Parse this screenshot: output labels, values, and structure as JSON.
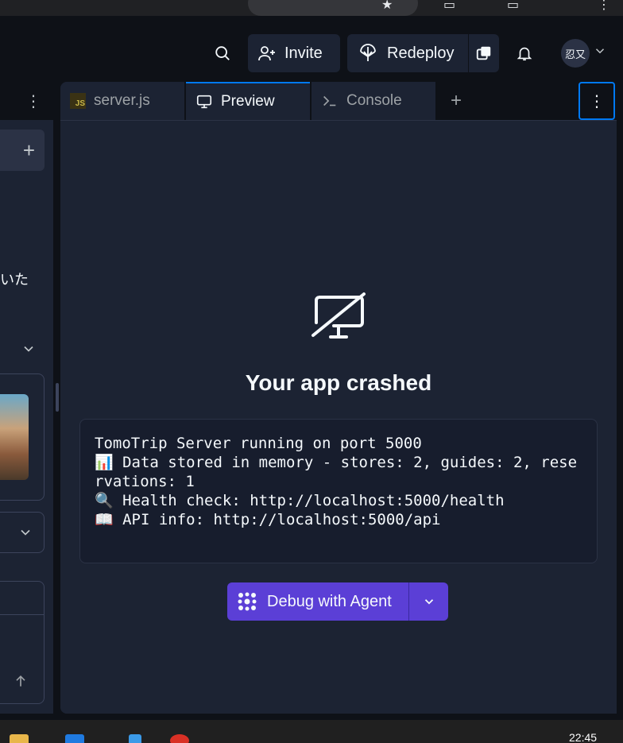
{
  "header": {
    "invite_label": "Invite",
    "redeploy_label": "Redeploy",
    "avatar_text": "忍又"
  },
  "tabs": [
    {
      "label": "server.js",
      "icon": "js-file-icon",
      "active": false
    },
    {
      "label": "Preview",
      "icon": "monitor-icon",
      "active": true
    },
    {
      "label": "Console",
      "icon": "terminal-icon",
      "active": false
    }
  ],
  "left_panel": {
    "snippet_text": "いた"
  },
  "preview": {
    "title": "Your app crashed",
    "log_lines": [
      "TomoTrip Server running on port 5000",
      "📊 Data stored in memory - stores: 2, guides: 2, reservations: 1",
      "🔍 Health check: http://localhost:5000/health",
      "📖 API info: http://localhost:5000/api"
    ],
    "debug_button_label": "Debug with Agent"
  },
  "taskbar": {
    "clock": "22:45"
  },
  "colors": {
    "accent_blue": "#0079f2",
    "debug_purple": "#5b3fd6",
    "panel_bg": "#1c2333",
    "page_bg": "#0e1117"
  }
}
